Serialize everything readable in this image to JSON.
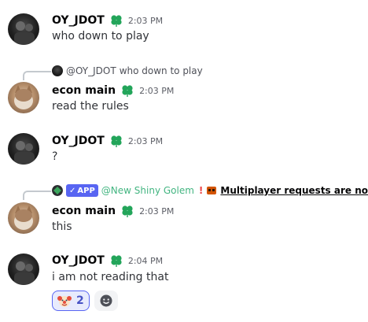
{
  "colors": {
    "username": "#060607",
    "timestamp": "#5c5e66",
    "bot_name": "#43b581",
    "app_tag": "#5865f2",
    "reaction_border": "#5865f2",
    "badge": "#23a55a"
  },
  "messages": [
    {
      "author": "OY_JDOT",
      "time": "2:03 PM",
      "text": "who down to play"
    },
    {
      "reply": {
        "author": "@OY_JDOT",
        "text": "who down to play"
      },
      "author": "econ main",
      "time": "2:03 PM",
      "text": "read the rules"
    },
    {
      "author": "OY_JDOT",
      "time": "2:03 PM",
      "text": "?"
    },
    {
      "reply": {
        "app_label": "APP",
        "author": "@New Shiny Golem",
        "text": "Multiplayer requests are no"
      },
      "author": "econ main",
      "time": "2:03 PM",
      "text": "this"
    },
    {
      "author": "OY_JDOT",
      "time": "2:04 PM",
      "text": "i am not reading that",
      "reactions": [
        {
          "emoji": "clown-face-icon",
          "count": "2"
        }
      ]
    }
  ]
}
